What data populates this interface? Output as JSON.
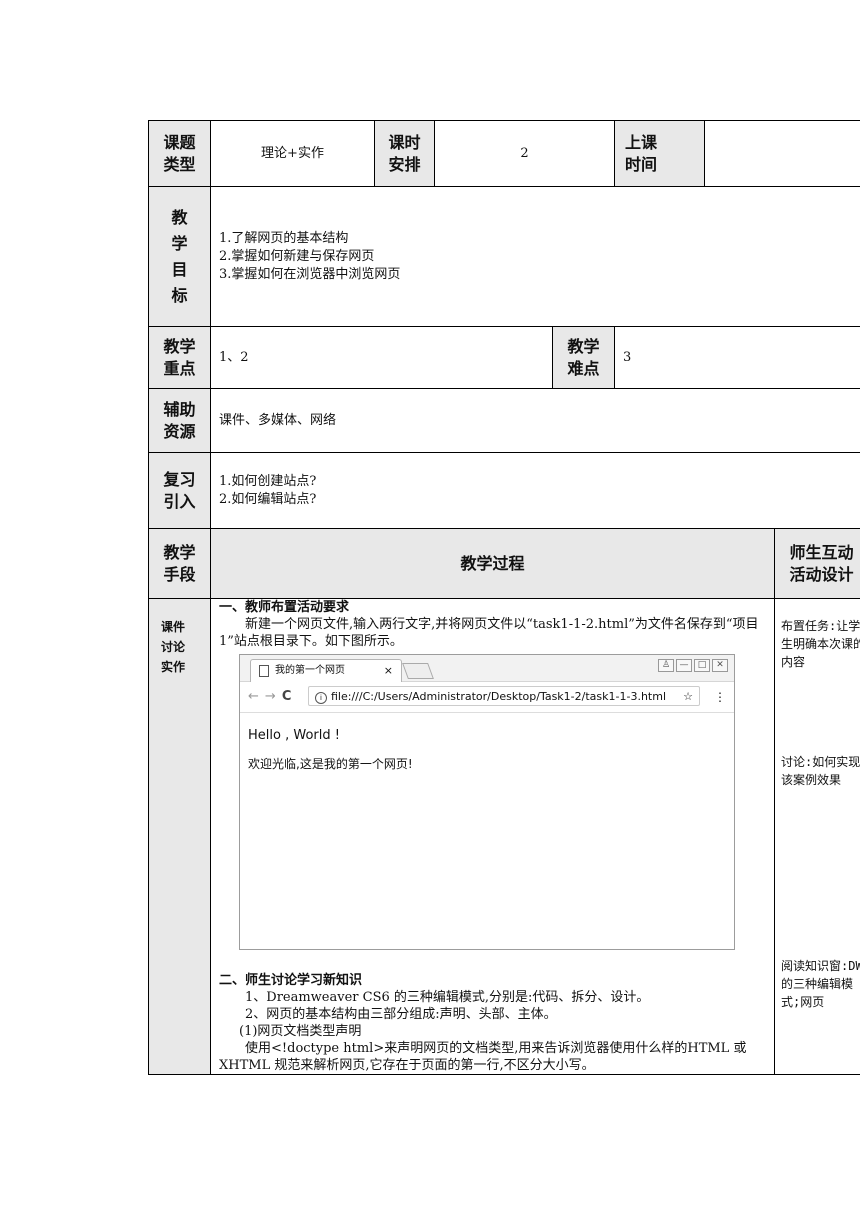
{
  "row1": {
    "type_label": "课题\n类型",
    "type_value": "理论+实作",
    "hours_label": "课时\n安排",
    "hours_value": "2",
    "time_label": "上课\n时间",
    "time_value": ""
  },
  "goals": {
    "label": "教\n学\n目\n标",
    "items": [
      "1.了解网页的基本结构",
      "2.掌握如何新建与保存网页",
      "3.掌握如何在浏览器中浏览网页"
    ]
  },
  "keypoints": {
    "label": "教学\n重点",
    "value": "1、2",
    "difficult_label": "教学\n难点",
    "difficult_value": "3"
  },
  "resources": {
    "label": "辅助\n资源",
    "value": "课件、多媒体、网络"
  },
  "review": {
    "label": "复习\n引入",
    "items": [
      "1.如何创建站点?",
      "2.如何编辑站点?"
    ]
  },
  "process_header": {
    "means_label": "教学\n手段",
    "process_label": "教学过程",
    "interaction_label": "师生互动\n活动设计"
  },
  "process": {
    "means": "课件\n讨论\n实作",
    "sec1_title": "一、教师布置活动要求",
    "sec1_text": "新建一个网页文件,输入两行文字,并将网页文件以“task1-1-2.html”为文件名保存到“项目 1”站点根目录下。如下图所示。",
    "browser": {
      "tab_title": "我的第一个网页",
      "tab_close": "×",
      "url": "file:///C:/Users/Administrator/Desktop/Task1-2/task1-1-3.html",
      "line1": "Hello , World !",
      "line2": "欢迎光临,这是我的第一个网页!"
    },
    "sec2_title": "二、师生讨论学习新知识",
    "p1": "1、Dreamweaver CS6 的三种编辑模式,分别是:代码、拆分、设计。",
    "p2": "2、网页的基本结构由三部分组成:声明、头部、主体。",
    "p3": "(1)网页文档类型声明",
    "p4": "使用<!doctype html>来声明网页的文档类型,用来告诉浏览器使用什么样的HTML 或 XHTML 规范来解析网页,它存在于页面的第一行,不区分大小写。",
    "side1": "布置任务:让学生明确本次课的内容",
    "side2": "讨论:如何实现该案例效果",
    "side3": "阅读知识窗:DW 的三种编辑模式;网页"
  }
}
